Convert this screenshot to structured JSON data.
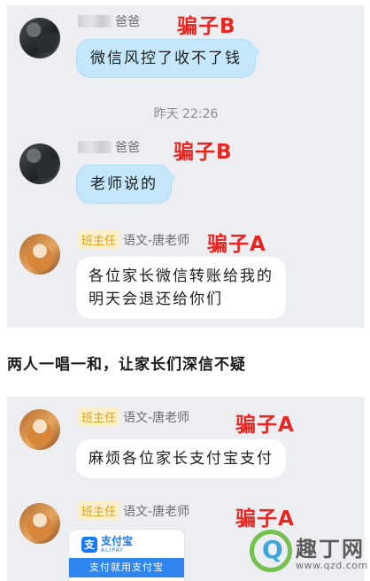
{
  "panel1": {
    "msg1": {
      "sender_suffix": "爸爸",
      "annotation": "骗子B",
      "text": "微信风控了收不了钱"
    },
    "timestamp": "昨天 22:26",
    "msg2": {
      "sender_suffix": "爸爸",
      "annotation": "骗子B",
      "text": "老师说的"
    },
    "msg3": {
      "role_badge": "班主任",
      "sender_name": "语文-唐老师",
      "annotation": "骗子A",
      "line1": "各位家长微信转账给我的",
      "line2": "明天会退还给你们"
    }
  },
  "caption": "两人一唱一和，让家长们深信不疑",
  "panel2": {
    "msg1": {
      "role_badge": "班主任",
      "sender_name": "语文-唐老师",
      "annotation": "骗子A",
      "text": "麻烦各位家长支付宝支付"
    },
    "msg2": {
      "role_badge": "班主任",
      "sender_name": "语文-唐老师",
      "annotation": "骗子A",
      "alipay": {
        "logo_glyph": "支",
        "name": "支付宝",
        "sub": "ALIPAY",
        "banner": "支付就用支付宝"
      }
    }
  },
  "watermark": {
    "letter": "Q",
    "name": "趣丁网",
    "url": "www.qzd.com"
  },
  "colors": {
    "annotation_red": "#e8261f",
    "blue_bubble": "#c4e7fb",
    "panel_bg": "#edeef2",
    "badge_bg": "#fcefc9",
    "badge_text": "#d9a21d",
    "alipay_blue": "#1677ff"
  }
}
